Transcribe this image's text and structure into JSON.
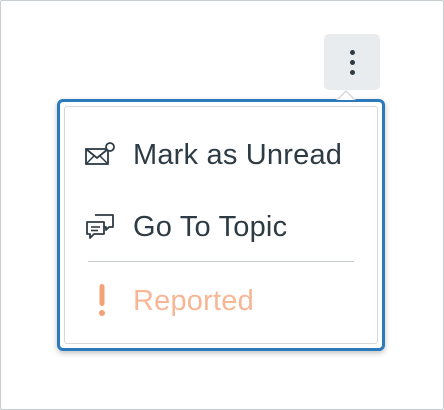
{
  "menu": {
    "items": [
      {
        "label": "Mark as Unread",
        "icon": "mail-unread-icon"
      },
      {
        "label": "Go To Topic",
        "icon": "discussion-icon"
      },
      {
        "label": "Reported",
        "icon": "warning-exclamation-icon"
      }
    ]
  },
  "colors": {
    "popover_border": "#2b7abc",
    "text": "#2d3b45",
    "reported": "#f7b796",
    "reported_icon": "#f2a376",
    "kebab_bg": "#e9ecee"
  }
}
